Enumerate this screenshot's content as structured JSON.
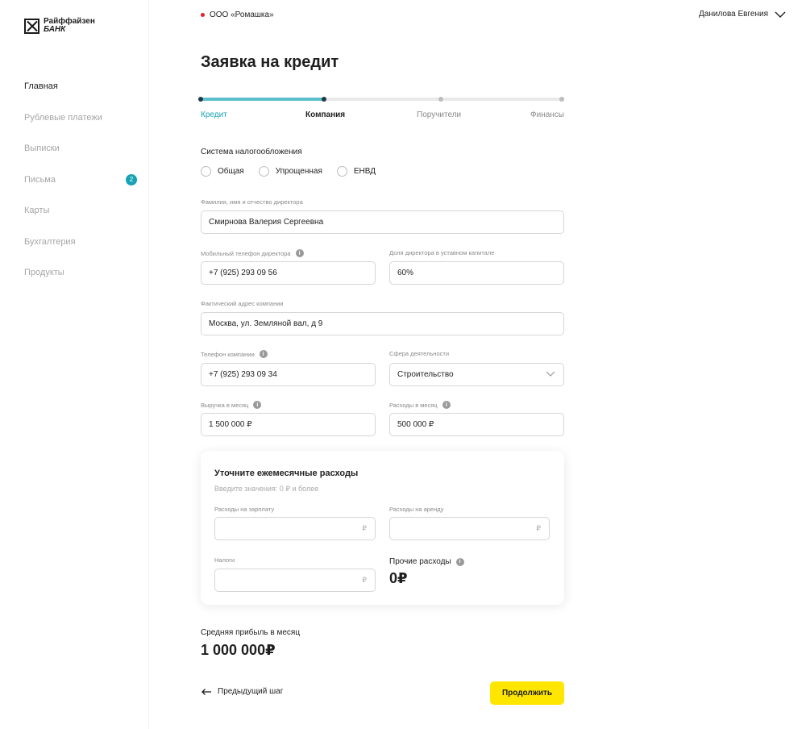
{
  "brand": {
    "line1": "Райффайзен",
    "line2": "БАНК"
  },
  "sidebar": {
    "items": [
      {
        "label": "Главная",
        "active": true
      },
      {
        "label": "Рублевые платежи"
      },
      {
        "label": "Выписки"
      },
      {
        "label": "Письма",
        "badge": "2"
      },
      {
        "label": "Карты"
      },
      {
        "label": "Бухгалтерия"
      },
      {
        "label": "Продукты"
      }
    ]
  },
  "header": {
    "company": "ООО «Ромашка»",
    "user": "Данилова Евгения",
    "accent_status": "#e8202a"
  },
  "page": {
    "title": "Заявка на кредит"
  },
  "steps": {
    "items": [
      {
        "label": "Кредит",
        "state": "done"
      },
      {
        "label": "Компания",
        "state": "current"
      },
      {
        "label": "Поручители",
        "state": "todo"
      },
      {
        "label": "Финансы",
        "state": "todo"
      }
    ],
    "progress": 0.34
  },
  "form": {
    "tax": {
      "label": "Система налогообложения",
      "options": [
        "Общая",
        "Упрощенная",
        "ЕНВД"
      ]
    },
    "director_name": {
      "label": "Фамилия, имя и отчество директора",
      "value": "Смирнова Валерия Сергеевна"
    },
    "director_phone": {
      "label": "Мобильный телефон директора",
      "value": "+7 (925) 293 09 56"
    },
    "director_share": {
      "label": "Доля директора в уставном капитале",
      "value": "60%"
    },
    "address": {
      "label": "Фактический адрес компании",
      "value": "Москва, ул. Земляной вал, д 9"
    },
    "company_phone": {
      "label": "Телефон компании",
      "value": "+7 (925) 293 09 34"
    },
    "industry": {
      "label": "Сфера деятельности",
      "value": "Строительство"
    },
    "revenue": {
      "label": "Выручка в месяц",
      "value": "1 500 000 ₽"
    },
    "expenses": {
      "label": "Расходы в месяц",
      "value": "500 000 ₽"
    }
  },
  "expenses_card": {
    "title": "Уточните ежемесячные расходы",
    "subtitle": "Введите значения: 0 ₽ и более",
    "salary": {
      "label": "Расходы на зарплату",
      "suffix": "₽"
    },
    "rent": {
      "label": "Расходы на аренду",
      "suffix": "₽"
    },
    "taxes": {
      "label": "Налоги",
      "suffix": "₽"
    },
    "other": {
      "label": "Прочие расходы",
      "value": "0₽"
    }
  },
  "profit": {
    "label": "Средняя прибыль в месяц",
    "value": "1 000 000₽"
  },
  "actions": {
    "back": "Предыдущий шаг",
    "next": "Продолжить"
  },
  "colors": {
    "accent": "#18a3b4",
    "progress": "#5bc0cb",
    "primary_button": "#fee600"
  },
  "icons": {
    "info": "i"
  }
}
